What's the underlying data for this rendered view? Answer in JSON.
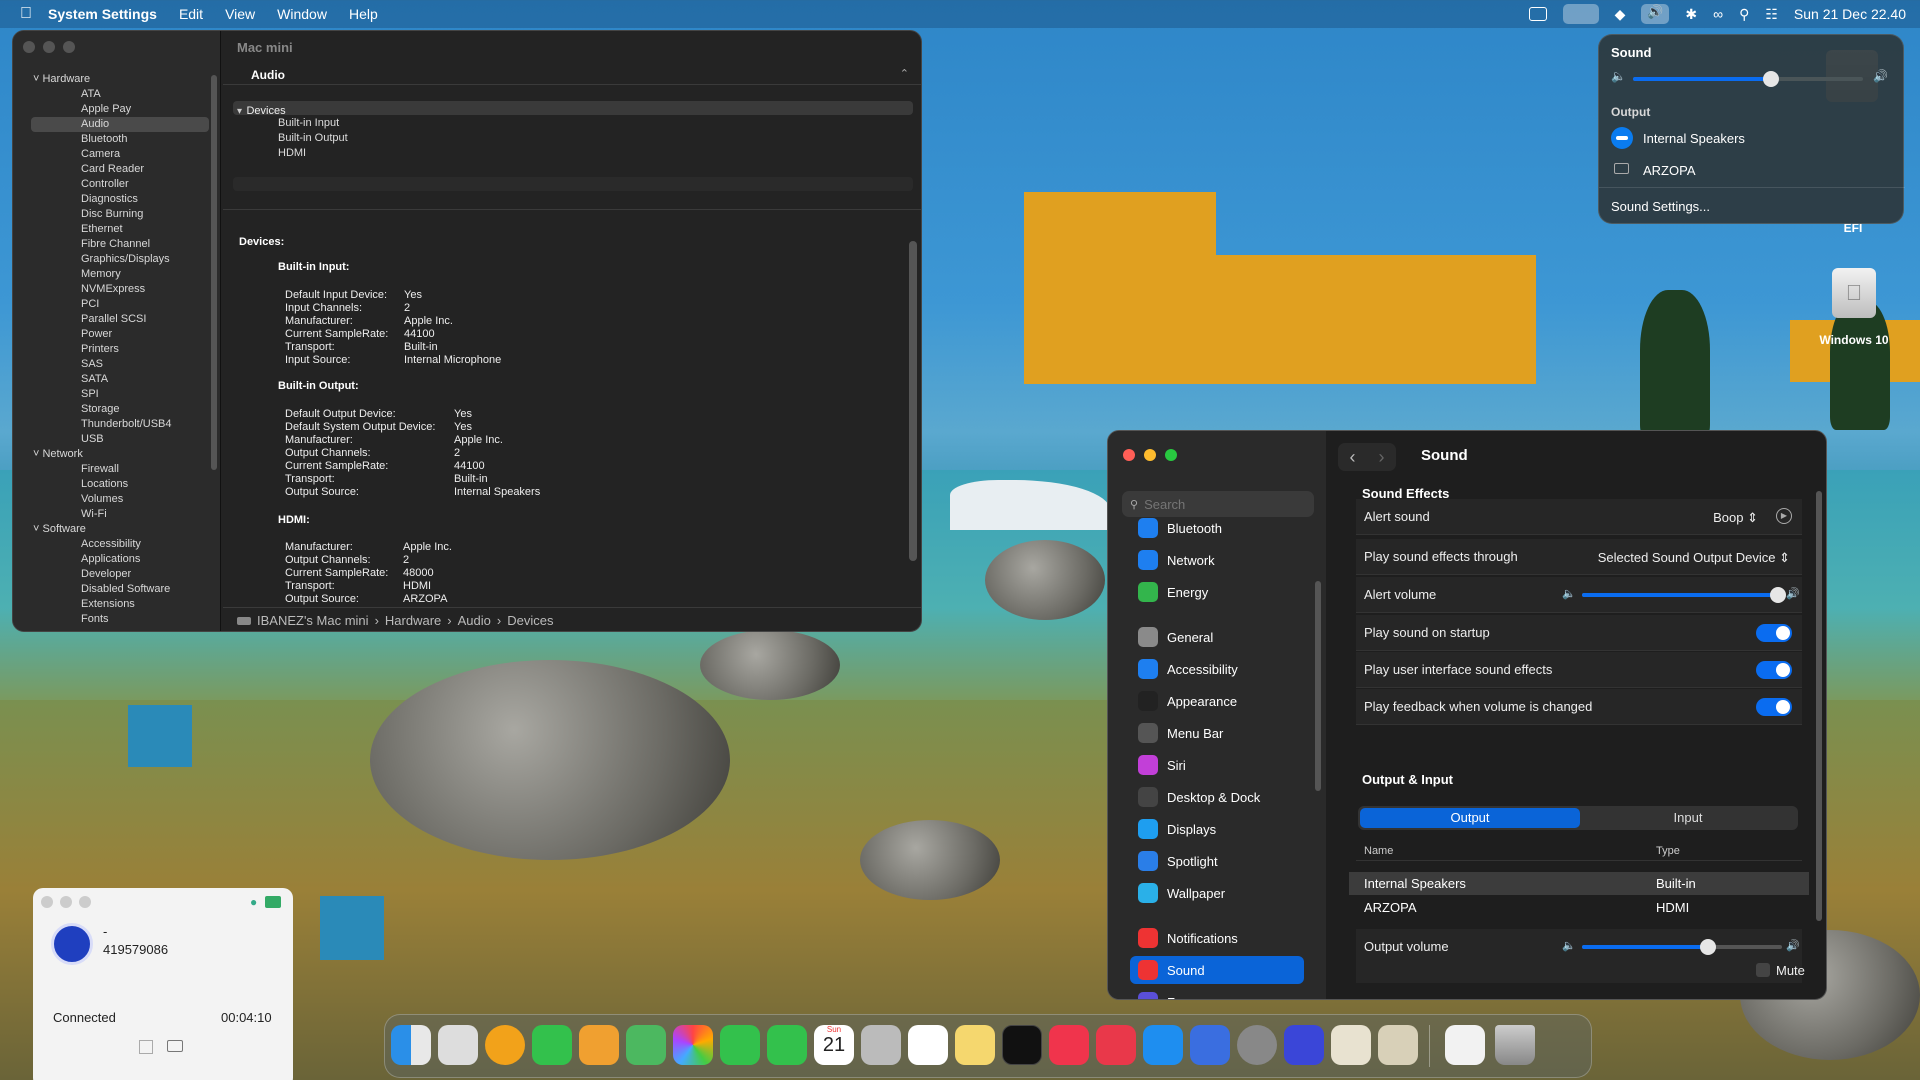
{
  "menubar": {
    "app_name": "System Settings",
    "menus": [
      "Edit",
      "View",
      "Window",
      "Help"
    ],
    "datetime": "Sun 21 Dec  22.40"
  },
  "desktop": {
    "drive_label": "EFI",
    "windows_label": "Windows 10"
  },
  "sysinfo": {
    "title": "Mac mini",
    "sidebar": {
      "hardware": "Hardware",
      "hardware_items": [
        "ATA",
        "Apple Pay",
        "Audio",
        "Bluetooth",
        "Camera",
        "Card Reader",
        "Controller",
        "Diagnostics",
        "Disc Burning",
        "Ethernet",
        "Fibre Channel",
        "Graphics/Displays",
        "Memory",
        "NVMExpress",
        "PCI",
        "Parallel SCSI",
        "Power",
        "Printers",
        "SAS",
        "SATA",
        "SPI",
        "Storage",
        "Thunderbolt/USB4",
        "USB"
      ],
      "selected": "Audio",
      "network": "Network",
      "network_items": [
        "Firewall",
        "Locations",
        "Volumes",
        "Wi-Fi"
      ],
      "software": "Software",
      "software_items": [
        "Accessibility",
        "Applications",
        "Developer",
        "Disabled Software",
        "Extensions",
        "Fonts"
      ]
    },
    "section_header": "Audio",
    "devices_group": "Devices",
    "devices": [
      "Built-in Input",
      "Built-in Output",
      "HDMI"
    ],
    "details_title": "Devices:",
    "builtin_input": {
      "title": "Built-in Input:",
      "rows": [
        [
          "Default Input Device:",
          "Yes"
        ],
        [
          "Input Channels:",
          "2"
        ],
        [
          "Manufacturer:",
          "Apple Inc."
        ],
        [
          "Current SampleRate:",
          "44100"
        ],
        [
          "Transport:",
          "Built-in"
        ],
        [
          "Input Source:",
          "Internal Microphone"
        ]
      ]
    },
    "builtin_output": {
      "title": "Built-in Output:",
      "rows": [
        [
          "Default Output Device:",
          "Yes"
        ],
        [
          "Default System Output Device:",
          "Yes"
        ],
        [
          "Manufacturer:",
          "Apple Inc."
        ],
        [
          "Output Channels:",
          "2"
        ],
        [
          "Current SampleRate:",
          "44100"
        ],
        [
          "Transport:",
          "Built-in"
        ],
        [
          "Output Source:",
          "Internal Speakers"
        ]
      ]
    },
    "hdmi": {
      "title": "HDMI:",
      "rows": [
        [
          "Manufacturer:",
          "Apple Inc."
        ],
        [
          "Output Channels:",
          "2"
        ],
        [
          "Current SampleRate:",
          "48000"
        ],
        [
          "Transport:",
          "HDMI"
        ],
        [
          "Output Source:",
          "ARZOPA"
        ]
      ]
    },
    "path": [
      "IBANEZ's Mac mini",
      "Hardware",
      "Audio",
      "Devices"
    ]
  },
  "control_center": {
    "title": "Sound",
    "volume": 0.6,
    "output_label": "Output",
    "devices": [
      "Internal Speakers",
      "ARZOPA"
    ],
    "settings_link": "Sound Settings..."
  },
  "settings": {
    "search_placeholder": "Search",
    "sidebar": [
      "Bluetooth",
      "Network",
      "Energy",
      "General",
      "Accessibility",
      "Appearance",
      "Menu Bar",
      "Siri",
      "Desktop & Dock",
      "Displays",
      "Spotlight",
      "Wallpaper",
      "Notifications",
      "Sound",
      "Focus"
    ],
    "selected": "Sound",
    "title": "Sound",
    "sound_effects_header": "Sound Effects",
    "alert_sound_label": "Alert sound",
    "alert_sound_value": "Boop",
    "play_through_label": "Play sound effects through",
    "play_through_value": "Selected Sound Output Device",
    "alert_volume_label": "Alert volume",
    "alert_volume": 0.98,
    "startup_label": "Play sound on startup",
    "ui_effects_label": "Play user interface sound effects",
    "feedback_label": "Play feedback when volume is changed",
    "output_input_header": "Output & Input",
    "tab_output": "Output",
    "tab_input": "Input",
    "col_name": "Name",
    "col_type": "Type",
    "devices": [
      [
        "Internal Speakers",
        "Built-in"
      ],
      [
        "ARZOPA",
        "HDMI"
      ]
    ],
    "output_volume_label": "Output volume",
    "output_volume": 0.63,
    "mute_label": "Mute"
  },
  "call": {
    "name": "-",
    "number": "419579086",
    "status": "Connected",
    "duration": "00:04:10"
  },
  "dock": {
    "date_day": "21",
    "date_month": "Sun"
  }
}
